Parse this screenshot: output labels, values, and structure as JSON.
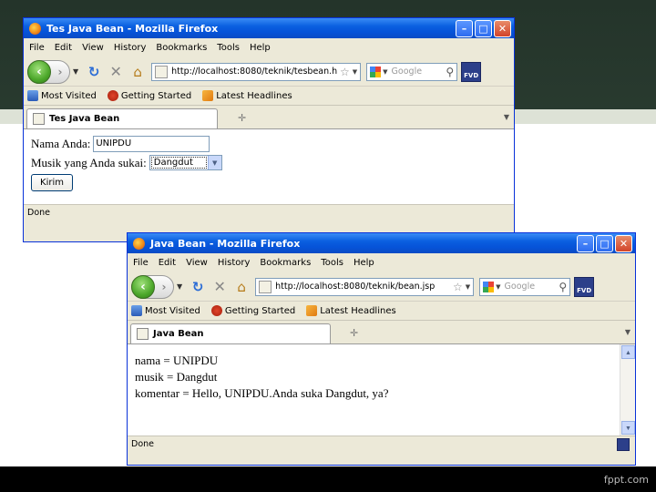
{
  "slide": {
    "footer": "fppt.com"
  },
  "window1": {
    "title": "Tes Java Bean - Mozilla Firefox",
    "menu": [
      "File",
      "Edit",
      "View",
      "History",
      "Bookmarks",
      "Tools",
      "Help"
    ],
    "url": "http://localhost:8080/teknik/tesbean.h",
    "search_placeholder": "Google",
    "bookmarks": [
      "Most Visited",
      "Getting Started",
      "Latest Headlines"
    ],
    "tab_title": "Tes Java Bean",
    "form": {
      "name_label": "Nama Anda:",
      "name_value": "UNIPDU",
      "music_label": "Musik yang Anda sukai:",
      "music_selected": "Dangdut",
      "submit_label": "Kirim"
    },
    "status": "Done"
  },
  "window2": {
    "title": "Java Bean - Mozilla Firefox",
    "menu": [
      "File",
      "Edit",
      "View",
      "History",
      "Bookmarks",
      "Tools",
      "Help"
    ],
    "url": "http://localhost:8080/teknik/bean.jsp",
    "search_placeholder": "Google",
    "bookmarks": [
      "Most Visited",
      "Getting Started",
      "Latest Headlines"
    ],
    "tab_title": "Java Bean",
    "result": [
      "nama = UNIPDU",
      "musik = Dangdut",
      "komentar = Hello, UNIPDU.Anda suka Dangdut, ya?"
    ],
    "status": "Done"
  }
}
